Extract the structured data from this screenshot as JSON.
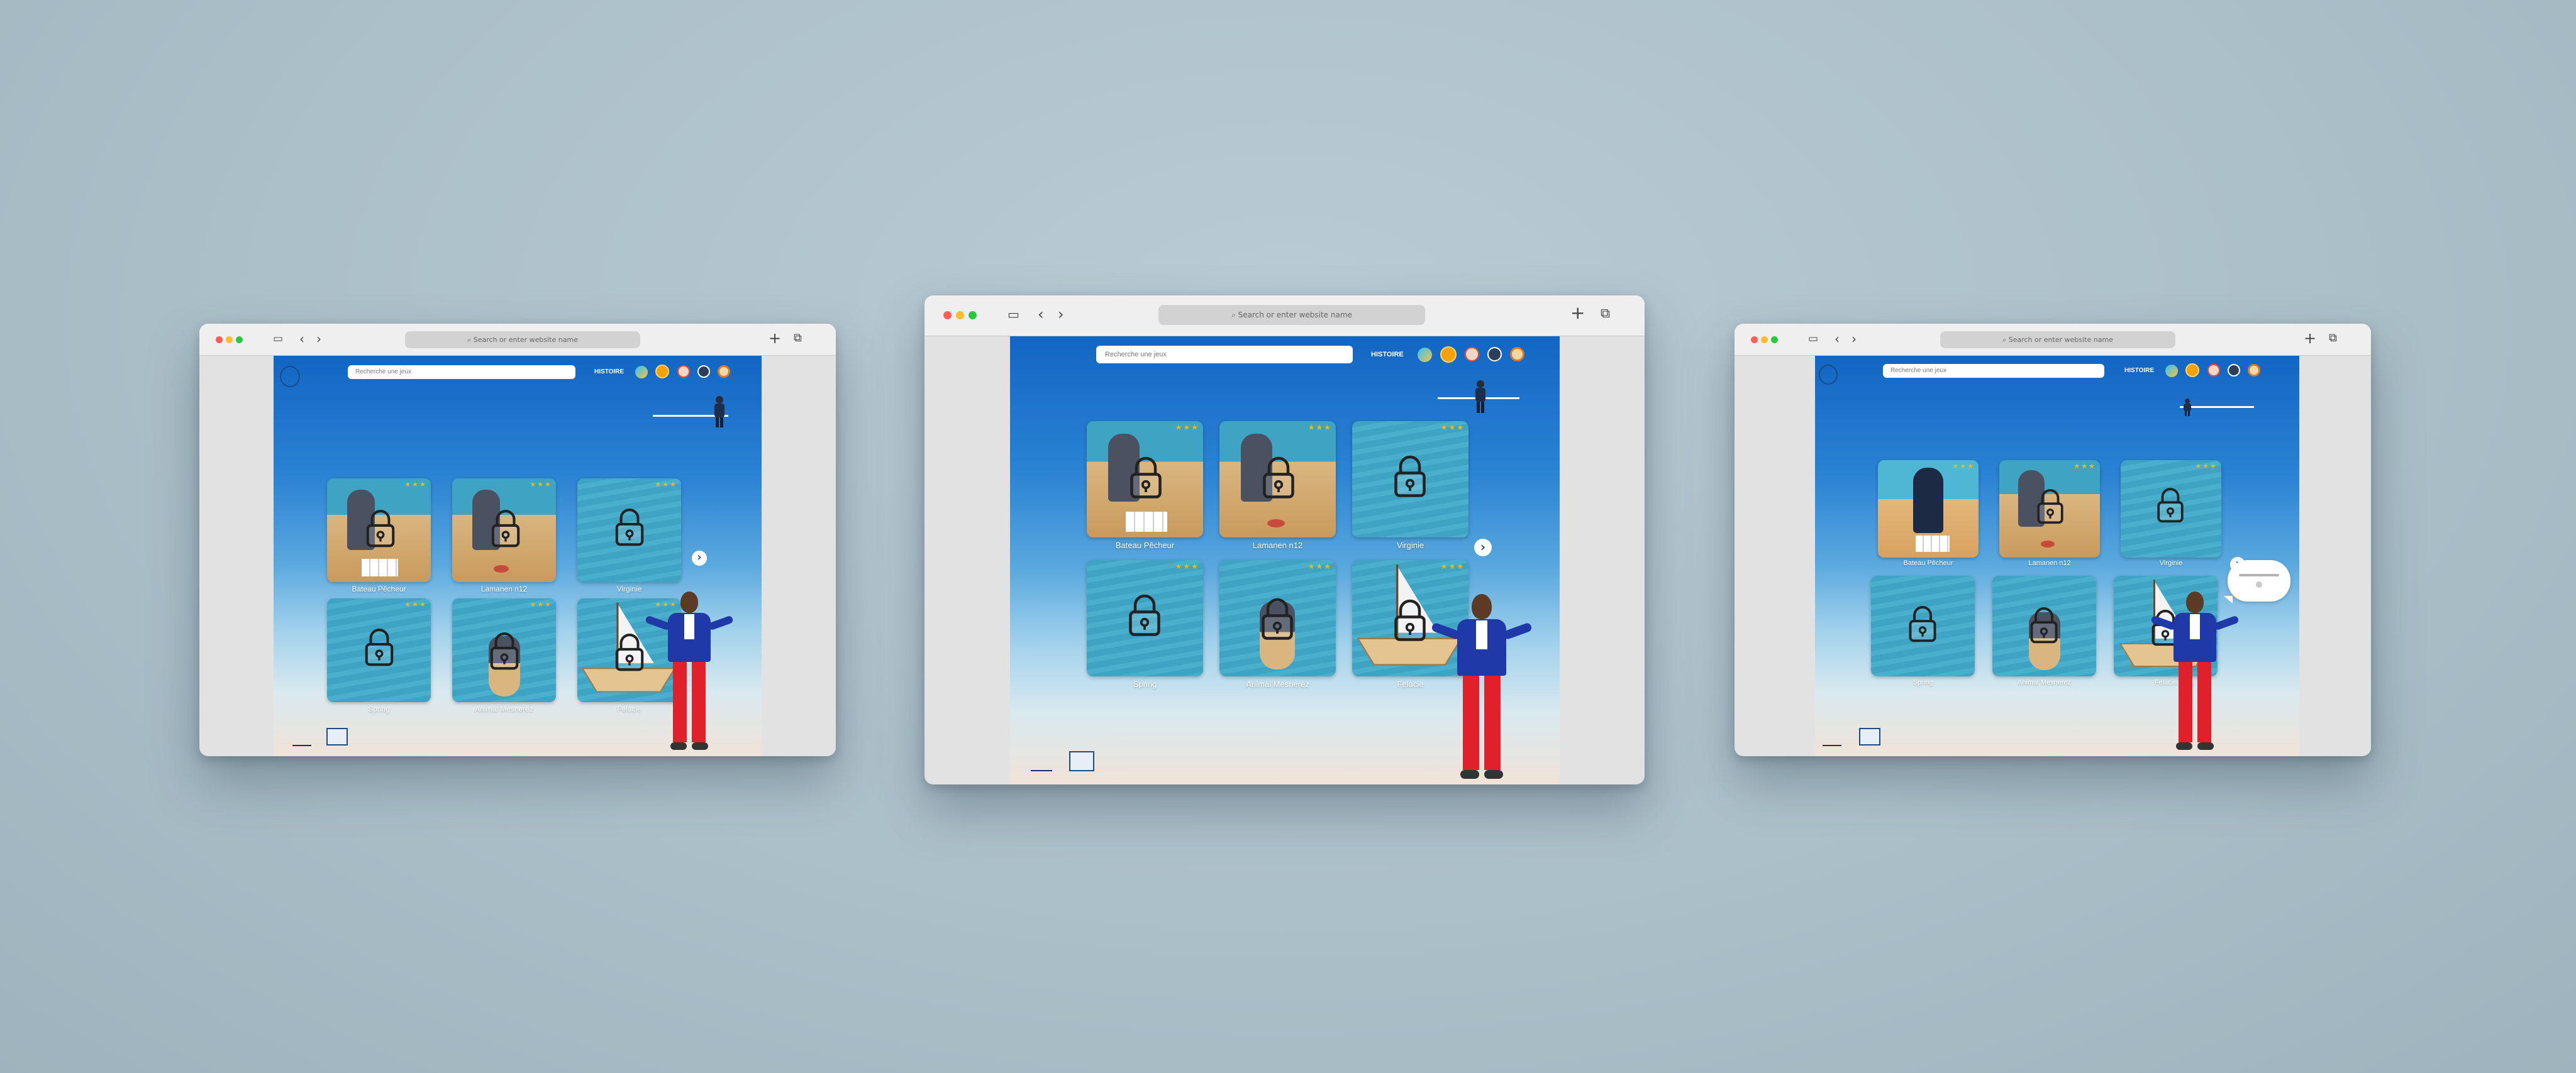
{
  "browser": {
    "url_placeholder": "Search or enter website name",
    "colors": {
      "close": "#ff5f57",
      "minimize": "#febc2e",
      "maximize": "#28c840"
    },
    "icons": {
      "sidebar": "sidebar-icon",
      "back": "chevron-left-icon",
      "forward": "chevron-right-icon",
      "new_tab": "plus-icon",
      "tabs": "tabs-overview-icon"
    }
  },
  "app": {
    "search_placeholder": "Recherche une jeux",
    "nav_label": "HISTOIRE",
    "games": [
      {
        "name": "Bateau Pêcheur",
        "stars": "★★★"
      },
      {
        "name": "Lamanen n12",
        "stars": "★★★"
      },
      {
        "name": "Virginie",
        "stars": "★★★"
      },
      {
        "name": "Spring",
        "stars": "★★★"
      },
      {
        "name": "Animal Mesnerez",
        "stars": "★★★"
      },
      {
        "name": "Felacie",
        "stars": "★★★"
      }
    ],
    "next_glyph": "›"
  }
}
